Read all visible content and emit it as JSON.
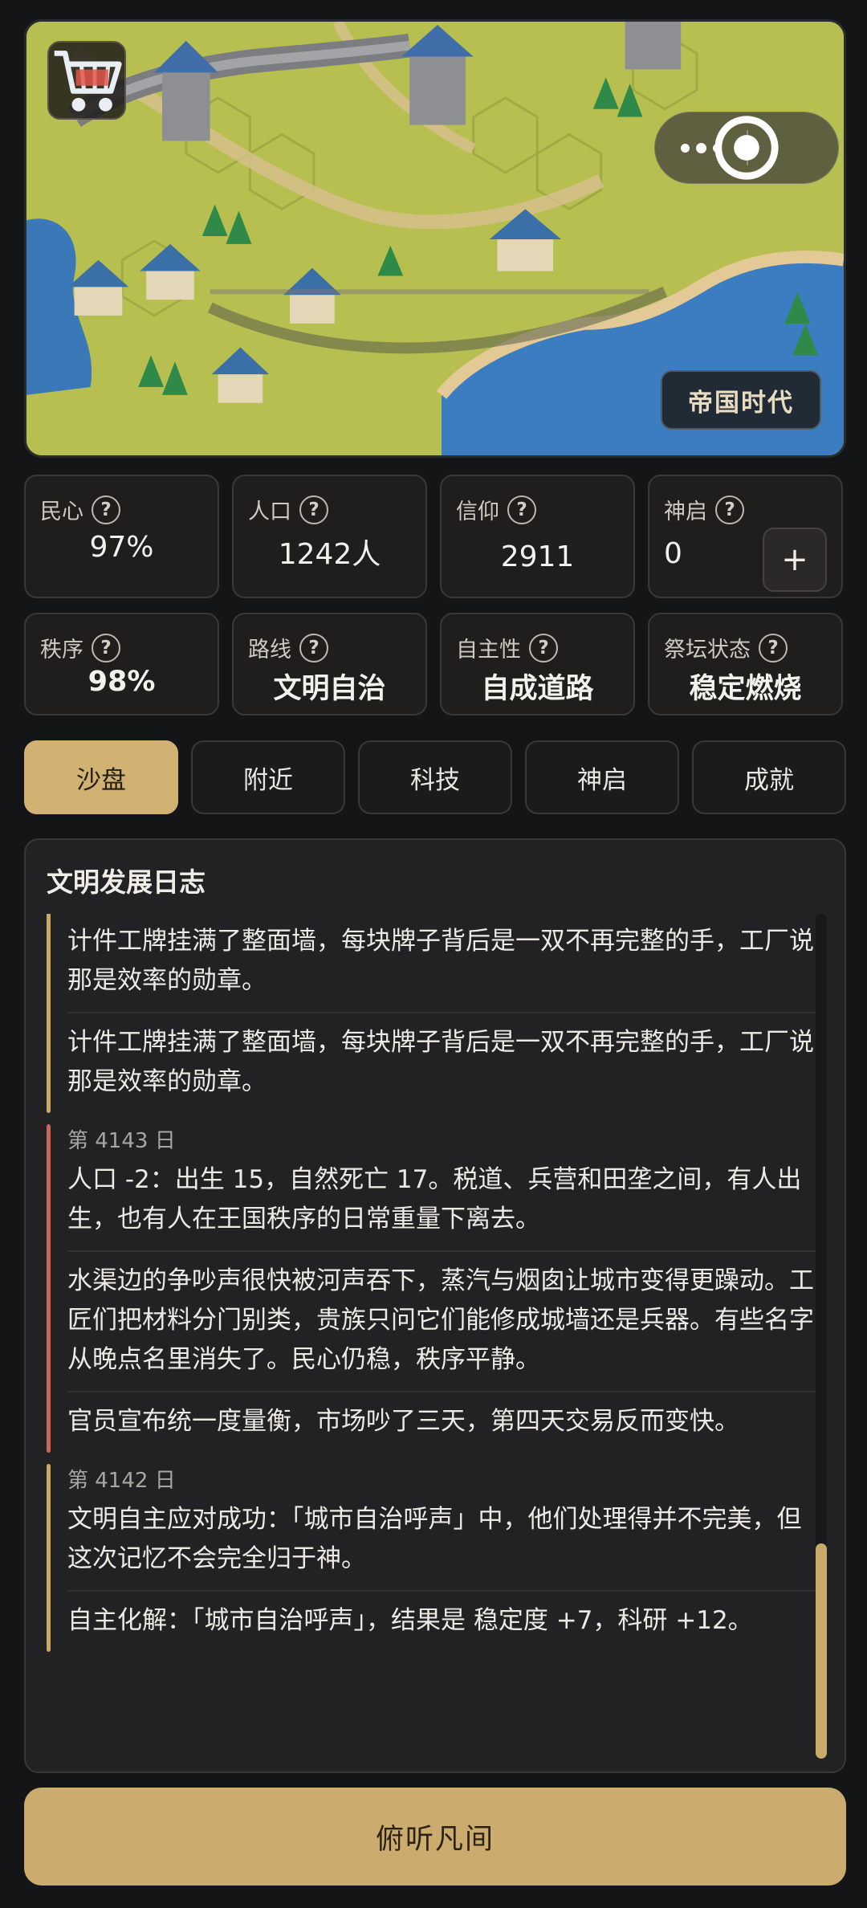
{
  "map": {
    "era_label": "帝国时代",
    "icons": [
      "shopping-cart-icon",
      "more-dots-icon",
      "target-icon"
    ]
  },
  "stats": {
    "minxin": {
      "label": "民心",
      "value": "97%"
    },
    "renkou": {
      "label": "人口",
      "value": "1242人"
    },
    "xinyang": {
      "label": "信仰",
      "value": "2911"
    },
    "shenqi": {
      "label": "神启",
      "value": "0",
      "action": "+"
    },
    "zhixu": {
      "label": "秩序",
      "value": "98%"
    },
    "luxian": {
      "label": "路线",
      "value": "文明自治"
    },
    "zizhu": {
      "label": "自主性",
      "value": "自成道路"
    },
    "jitan": {
      "label": "祭坛状态",
      "value": "稳定燃烧"
    },
    "help_glyph": "?"
  },
  "tabs": [
    "沙盘",
    "附近",
    "科技",
    "神启",
    "成就"
  ],
  "active_tab": "沙盘",
  "log": {
    "title": "文明发展日志",
    "entries": [
      {
        "day": "",
        "paragraphs": [
          "计件工牌挂满了整面墙，每块牌子背后是一双不再完整的手，工厂说那是效率的勋章。",
          "计件工牌挂满了整面墙，每块牌子背后是一双不再完整的手，工厂说那是效率的勋章。"
        ]
      },
      {
        "day": "第 4143 日",
        "paragraphs": [
          "人口 -2：出生 15，自然死亡 17。税道、兵营和田垄之间，有人出生，也有人在王国秩序的日常重量下离去。",
          "水渠边的争吵声很快被河声吞下，蒸汽与烟囱让城市变得更躁动。工匠们把材料分门别类，贵族只问它们能修成城墙还是兵器。有些名字从晚点名里消失了。民心仍稳，秩序平静。",
          "官员宣布统一度量衡，市场吵了三天，第四天交易反而变快。"
        ]
      },
      {
        "day": "第 4142 日",
        "paragraphs": [
          "文明自主应对成功：「城市自治呼声」中，他们处理得并不完美，但这次记忆不会完全归于神。",
          "自主化解：「城市自治呼声」，结果是 稳定度 +7，科研 +12。"
        ]
      }
    ]
  },
  "primary_action": "俯听凡间",
  "colors": {
    "accent_gold": "#d2b272",
    "bar_gold": "#c9a866",
    "bar_red": "#c7675a",
    "background": "#141516"
  }
}
